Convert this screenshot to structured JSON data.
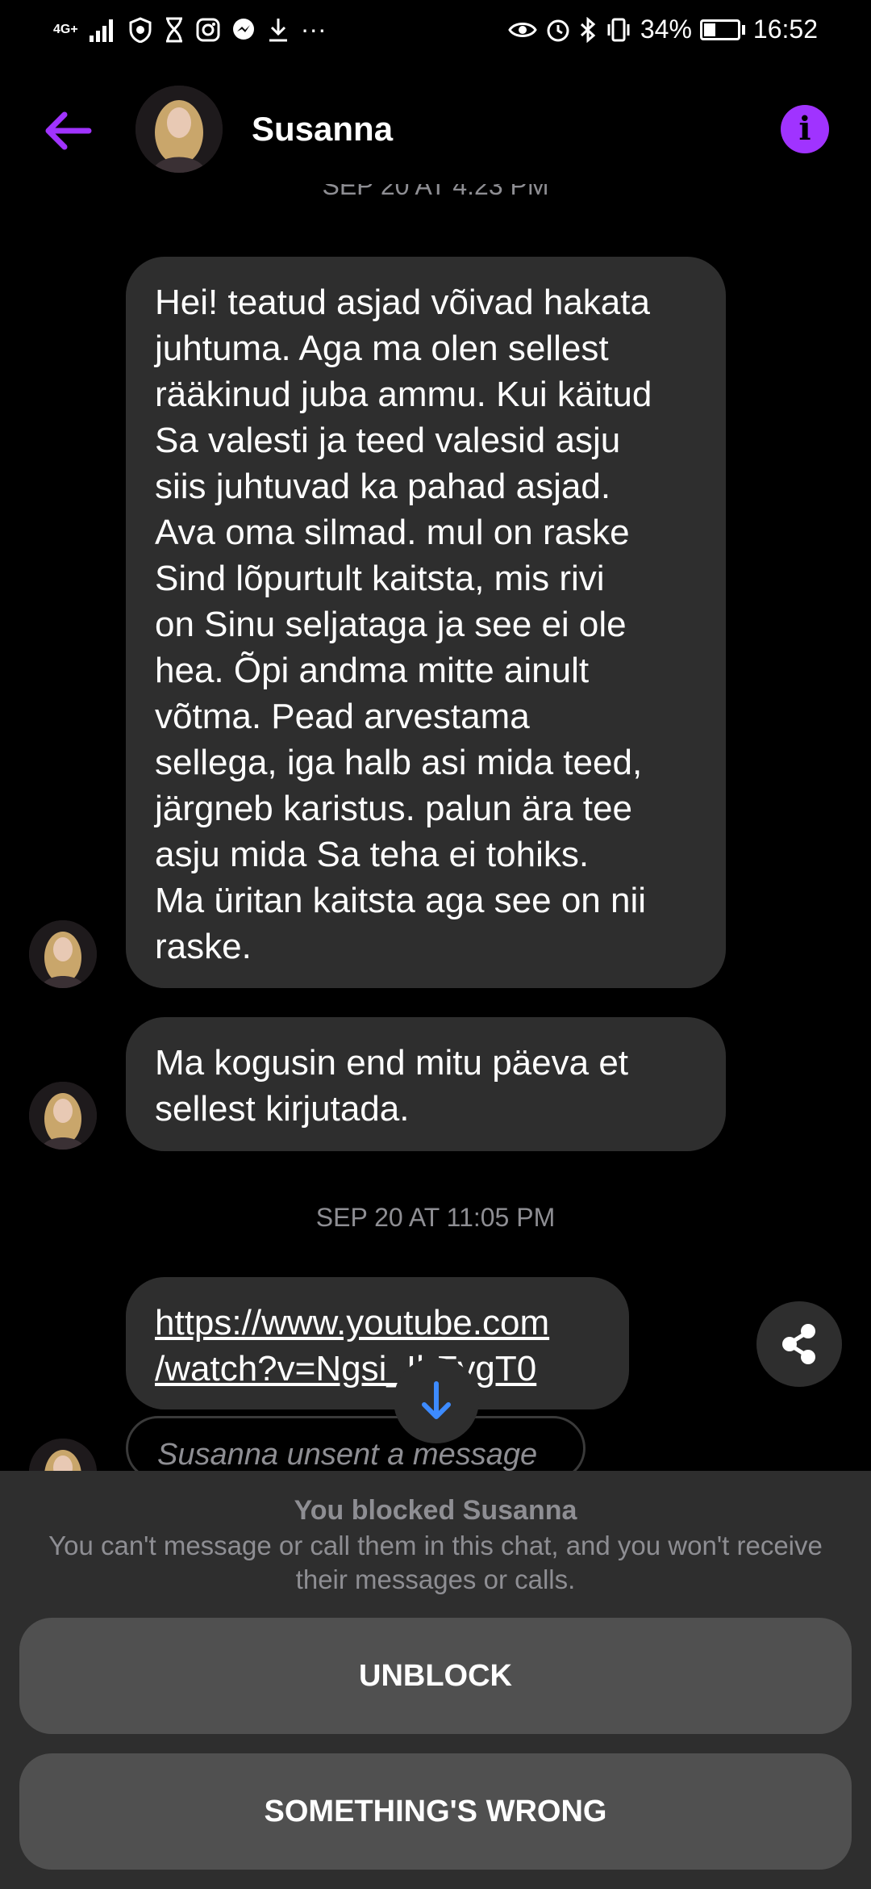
{
  "status_bar": {
    "network": "4G+",
    "battery": "34%",
    "battery_level": 0.34,
    "time": "16:52"
  },
  "header": {
    "contact_name": "Susanna",
    "info_glyph": "i"
  },
  "messages": {
    "timestamp_top": "SEP 20 AT 4:23 PM",
    "bubble_1": "Hei! teatud asjad võivad hakata\njuhtuma. Aga ma olen sellest\nrääkinud juba ammu. Kui käitud\nSa valesti ja teed valesid asju\nsiis juhtuvad ka pahad asjad.\nAva oma silmad. mul on raske\nSind lõpurtult kaitsta, mis rivi\non Sinu seljataga ja see ei ole\nhea. Õpi andma mitte ainult\nvõtma. Pead arvestama\nsellega, iga halb asi mida teed,\njärgneb karistus. palun ära tee\nasju mida Sa teha ei tohiks.\nMa üritan kaitsta aga see on nii\nraske.",
    "bubble_2": "Ma kogusin end mitu päeva et\nsellest kirjutada.",
    "timestamp_2": "SEP 20 AT 11:05 PM",
    "link": "https://www.youtube.com\n/watch?v=Ngsi_IhFygT0",
    "unsent": "Susanna unsent a message"
  },
  "blocked_panel": {
    "title": "You blocked Susanna",
    "description": "You can't message or call them in this chat, and you won't receive their messages or calls.",
    "unblock_label": "UNBLOCK",
    "something_wrong_label": "SOMETHING'S WRONG"
  },
  "colors": {
    "accent": "#a033ff",
    "bubble": "#2e2e2e",
    "muted_text": "#8e8e93",
    "link_arrow": "#3d8bff"
  }
}
